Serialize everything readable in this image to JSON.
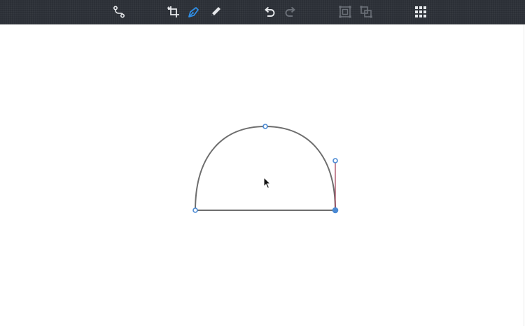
{
  "toolbar": {
    "tools": [
      {
        "name": "node-tool",
        "icon": "path-nodes-icon",
        "active": false
      },
      {
        "name": "crop-tool",
        "icon": "crop-icon",
        "active": false
      },
      {
        "name": "pen-tool",
        "icon": "pen-icon",
        "active": true
      },
      {
        "name": "pencil-tool",
        "icon": "pencil-icon",
        "active": false
      },
      {
        "name": "undo",
        "icon": "undo-icon",
        "enabled": true
      },
      {
        "name": "redo",
        "icon": "redo-icon",
        "enabled": false
      },
      {
        "name": "select-bounds",
        "icon": "bounding-box-icon",
        "enabled": false
      },
      {
        "name": "transform-bounds",
        "icon": "transform-box-icon",
        "enabled": false
      },
      {
        "name": "grid-menu",
        "icon": "grid-menu-icon",
        "enabled": true
      }
    ],
    "colors": {
      "background": "#2b2f36",
      "icon": "#e6e8eb",
      "icon_disabled": "#6b7078",
      "active": "#2f8ee6"
    }
  },
  "canvas": {
    "shape": "half-circle path",
    "colors": {
      "stroke": "#6e6e6e",
      "anchor": "#4a8ad4",
      "handle_line": "#a03a52"
    }
  }
}
